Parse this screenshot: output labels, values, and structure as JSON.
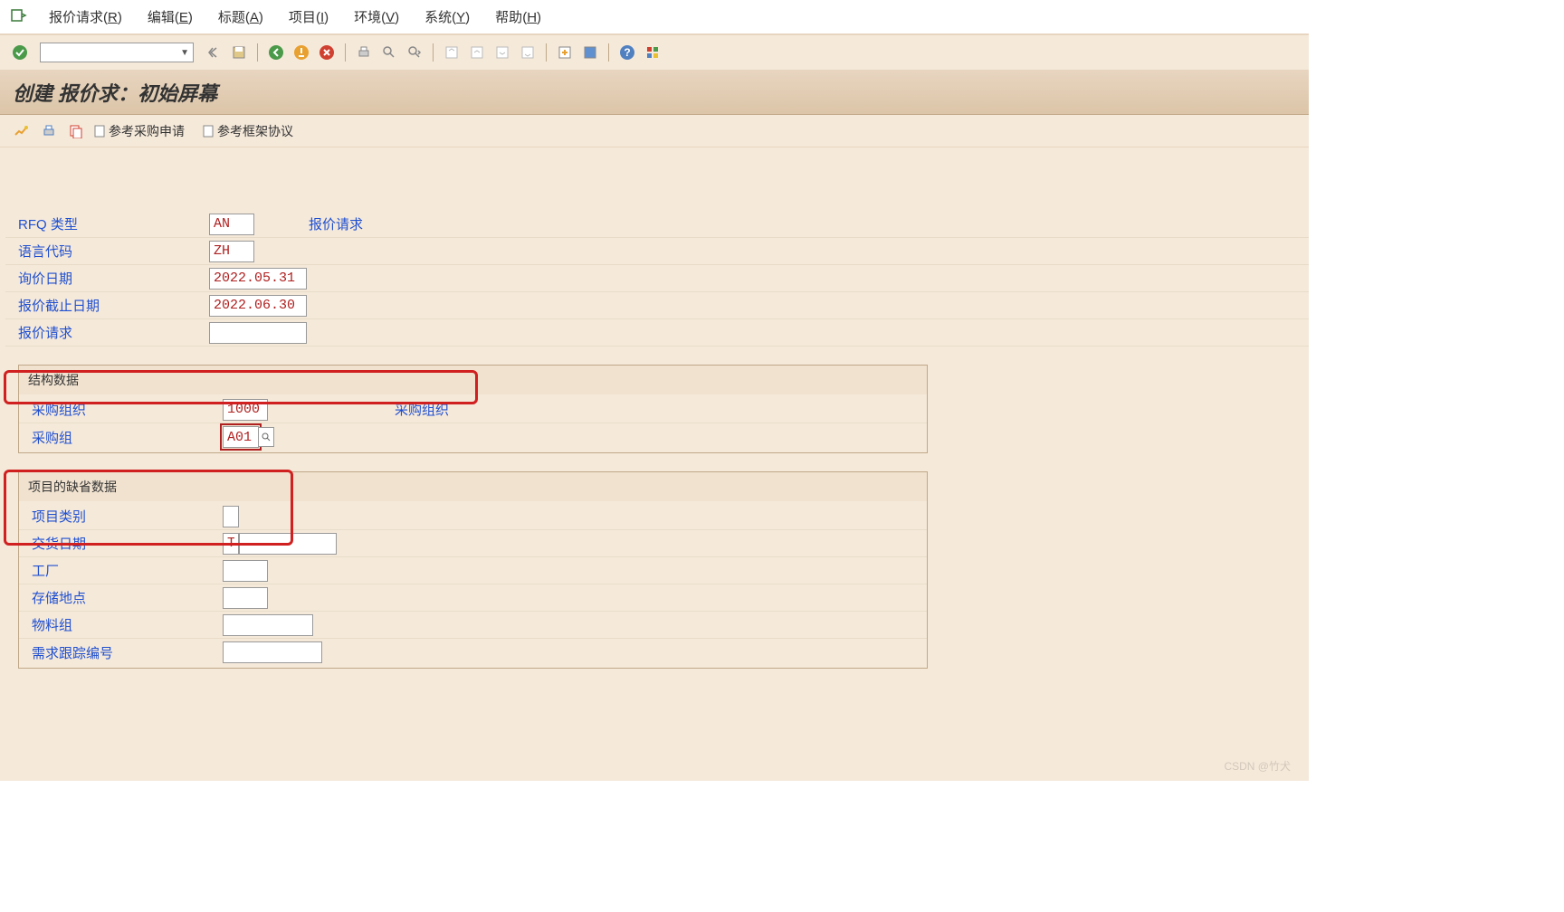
{
  "menubar": {
    "items": [
      {
        "label": "报价请求",
        "key": "R"
      },
      {
        "label": "编辑",
        "key": "E"
      },
      {
        "label": "标题",
        "key": "A"
      },
      {
        "label": "项目",
        "key": "I"
      },
      {
        "label": "环境",
        "key": "V"
      },
      {
        "label": "系统",
        "key": "Y"
      },
      {
        "label": "帮助",
        "key": "H"
      }
    ]
  },
  "title": "创建 报价求：初始屏幕",
  "apptoolbar": {
    "ref_pr": "参考采购申请",
    "ref_oa": "参考框架协议"
  },
  "fields": {
    "rfq_type": {
      "label": "RFQ 类型",
      "value": "AN",
      "desc": "报价请求"
    },
    "lang": {
      "label": "语言代码",
      "value": "ZH"
    },
    "rfq_date": {
      "label": "询价日期",
      "value": "2022.05.31"
    },
    "deadline": {
      "label": "报价截止日期",
      "value": "2022.06.30"
    },
    "rfq_no": {
      "label": "报价请求",
      "value": ""
    }
  },
  "org_group": {
    "title": "结构数据",
    "purch_org": {
      "label": "采购组织",
      "value": "1000",
      "desc": "采购组织"
    },
    "purch_grp": {
      "label": "采购组",
      "value": "A01"
    }
  },
  "default_group": {
    "title": "项目的缺省数据",
    "item_cat": {
      "label": "项目类别",
      "value": ""
    },
    "deliv_date": {
      "label": "交货日期",
      "type": "T",
      "value": ""
    },
    "plant": {
      "label": "工厂",
      "value": ""
    },
    "stor_loc": {
      "label": "存储地点",
      "value": ""
    },
    "matl_grp": {
      "label": "物料组",
      "value": ""
    },
    "req_tracking": {
      "label": "需求跟踪编号",
      "value": ""
    }
  },
  "watermark": "CSDN @竹犬"
}
